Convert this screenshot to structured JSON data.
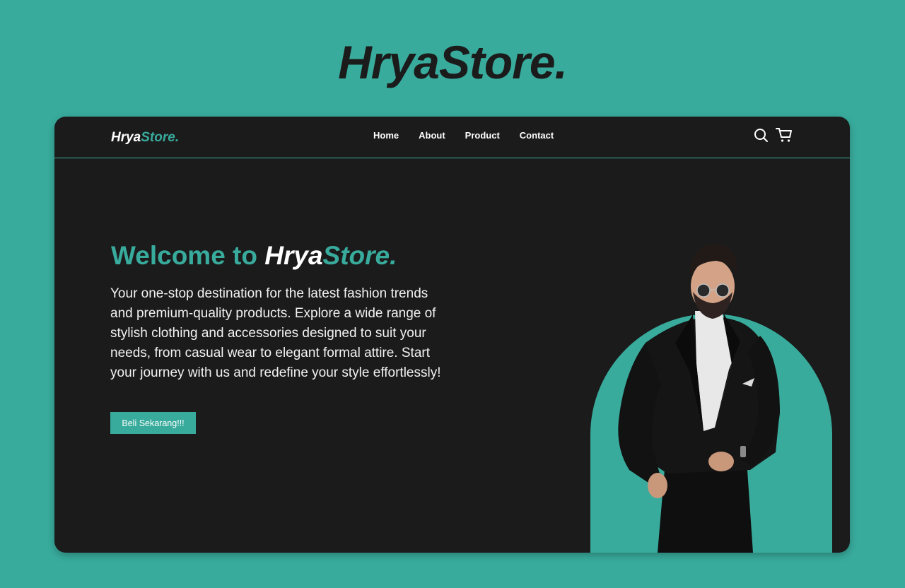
{
  "page": {
    "title": "HryaStore."
  },
  "navbar": {
    "logo_main": "Hrya",
    "logo_accent": "Store.",
    "links": [
      {
        "label": "Home"
      },
      {
        "label": "About"
      },
      {
        "label": "Product"
      },
      {
        "label": "Contact"
      }
    ],
    "icons": [
      "search-icon",
      "cart-icon"
    ]
  },
  "hero": {
    "title_prefix": "Welcome to ",
    "brand_main": "Hrya",
    "brand_accent": "Store.",
    "description": "Your one-stop destination for the latest fashion trends and premium-quality products. Explore a wide range of stylish clothing and accessories designed to suit your needs, from casual wear to elegant formal attire. Start your journey with us and redefine your style effortlessly!",
    "cta_label": "Beli Sekarang!!!"
  },
  "colors": {
    "background": "#38ab9c",
    "panel": "#1b1b1b",
    "accent": "#38ab9c",
    "text_light": "#ffffff"
  }
}
